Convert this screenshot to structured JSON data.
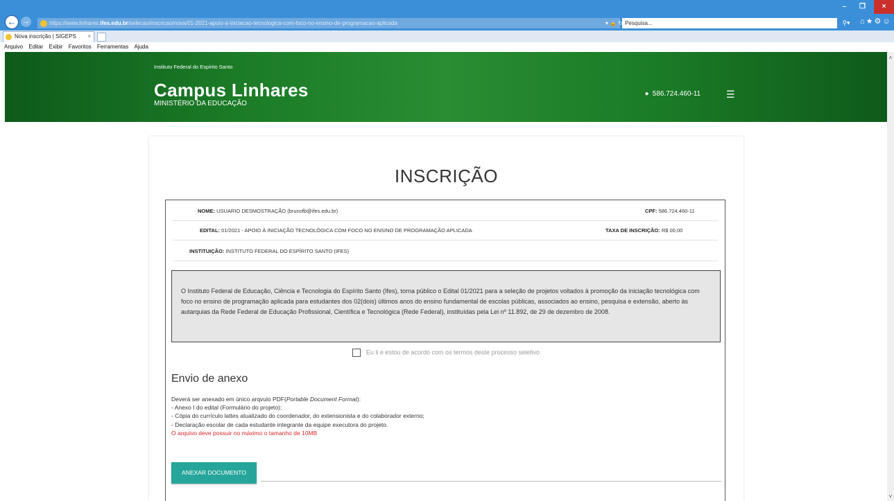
{
  "browser": {
    "url_prefix": "https://www.linhares.",
    "url_domain": "ifes.edu.br",
    "url_path": "/selecao/inscricao/nova/01-2021-apoio-a-iniciacao-tecnologica-com-foco-no-ensino-de-programacao-aplicada",
    "search_placeholder": "Pesquisa...",
    "tab_title": "Nova inscrição | SIGEPS",
    "menu": [
      "Arquivo",
      "Editar",
      "Exibir",
      "Favoritos",
      "Ferramentas",
      "Ajuda"
    ]
  },
  "header": {
    "institution": "Instituto Federal do Espírito Santo",
    "campus": "Campus Linhares",
    "ministry": "MINISTÉRIO DA EDUCAÇÃO",
    "user_cpf": "586.724.460-11"
  },
  "main": {
    "title": "INSCRIÇÃO",
    "info": {
      "nome_label": "NOME:",
      "nome_value": "USUARIO DESMOSTRAÇÃO (brunofb@ifes.edu.br)",
      "cpf_label": "CPF:",
      "cpf_value": "586.724.460-11",
      "edital_label": "EDITAL:",
      "edital_value": "01/2021 - APOIO À INICIAÇÃO TECNOLÓGICA COM FOCO NO ENSINO DE PROGRAMAÇÃO APLICADA",
      "taxa_label": "TAXA DE INSCRIÇÃO:",
      "taxa_value": "R$ 00,00",
      "instituicao_label": "INSTITUIÇÃO:",
      "instituicao_value": "INSTITUTO FEDERAL DO ESPÍRITO SANTO (IFES)"
    },
    "notice": "O Instituto Federal de Educação, Ciência e Tecnologia do Espírito Santo (Ifes), torna público o Edital 01/2021 para a seleção de projetos voltados à promoção da iniciação tecnológica com foco no ensino de programação aplicada para estudantes dos 02(dois) últimos anos do ensino fundamental de escolas públicas, associados ao ensino, pesquisa e extensão, aberto às autarquias da Rede Federal de Educação Profissional, Científica e Tecnológica (Rede Federal), instituídas pela Lei nº 11.892, de 29 de dezembro de 2008.",
    "agree_label": "Eu li e estou de acordo com os termos deste processo seletivo",
    "attach": {
      "heading": "Envio de anexo",
      "intro_prefix": "Deverá ser anexado em único arqvuio PDF(",
      "intro_italic": "Portable Document Format",
      "intro_suffix": "):",
      "items": [
        "- Anexo I do edital (Formulário do projeto);",
        "- Cópia do currículo lattes atualizado do coordenador, do extensionista e do colaborador externo;",
        "- Declaração escolar de cada estudante integrante da equipe executora do projeto."
      ],
      "warning": "O arquivo deve possuir no máximo o tamanho de 10MB",
      "button": "ANEXAR DOCUMENTO"
    }
  },
  "colors": {
    "header_green": "#1a7a26",
    "button_teal": "#26a69a",
    "warning_red": "#d9262a",
    "browser_blue": "#3b8fd9"
  }
}
